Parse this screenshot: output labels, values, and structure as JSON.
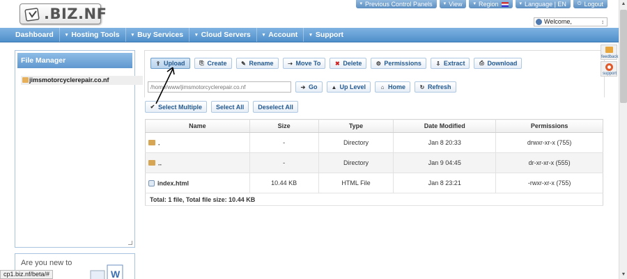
{
  "header": {
    "logo_text": ".BIZ.NF",
    "toplinks": [
      {
        "label": "Previous Control Panels"
      },
      {
        "label": "View"
      },
      {
        "label": "Region"
      },
      {
        "label": "Language | EN"
      },
      {
        "label": "Logout"
      }
    ],
    "welcome": "Welcome,"
  },
  "nav": {
    "items": [
      {
        "label": "Dashboard"
      },
      {
        "label": "Hosting Tools"
      },
      {
        "label": "Buy Services"
      },
      {
        "label": "Cloud Servers"
      },
      {
        "label": "Account"
      },
      {
        "label": "Support"
      }
    ]
  },
  "sidebar": {
    "title": "File Manager",
    "tree": [
      {
        "label": "jimsmotorcyclerepair.co.nf"
      }
    ],
    "new_box_text": "Are you new to"
  },
  "toolbar": {
    "buttons": [
      {
        "label": "Upload",
        "icon": "upload-icon",
        "glyph": "⇪"
      },
      {
        "label": "Create",
        "icon": "create-icon",
        "glyph": "⎘"
      },
      {
        "label": "Rename",
        "icon": "rename-icon",
        "glyph": "✎"
      },
      {
        "label": "Move To",
        "icon": "move-icon",
        "glyph": "⇢"
      },
      {
        "label": "Delete",
        "icon": "delete-icon",
        "glyph": "✖"
      },
      {
        "label": "Permissions",
        "icon": "gear-icon",
        "glyph": "⚙"
      },
      {
        "label": "Extract",
        "icon": "extract-icon",
        "glyph": "⇩"
      },
      {
        "label": "Download",
        "icon": "download-icon",
        "glyph": "⎙"
      }
    ]
  },
  "path": {
    "value": "/home/www/jimsmotorcyclerepair.co.nf",
    "buttons": [
      {
        "label": "Go",
        "glyph": "➔"
      },
      {
        "label": "Up Level",
        "glyph": "▲"
      },
      {
        "label": "Home",
        "glyph": "⌂"
      },
      {
        "label": "Refresh",
        "glyph": "↻"
      }
    ]
  },
  "selection": {
    "select_multiple": "Select Multiple",
    "select_all": "Select All",
    "deselect_all": "Deselect All"
  },
  "table": {
    "columns": [
      "Name",
      "Size",
      "Type",
      "Date Modified",
      "Permissions"
    ],
    "rows": [
      {
        "name": ".",
        "size": "-",
        "type": "Directory",
        "date": "Jan 8 20:33",
        "perms": "drwxr-xr-x (755)",
        "kind": "folder"
      },
      {
        "name": "..",
        "size": "-",
        "type": "Directory",
        "date": "Jan 9 04:45",
        "perms": "dr-xr-xr-x (555)",
        "kind": "folder"
      },
      {
        "name": "index.html",
        "size": "10.44 KB",
        "type": "HTML File",
        "date": "Jan 8 23:21",
        "perms": "-rwxr-xr-x (755)",
        "kind": "html"
      }
    ],
    "footer": "Total: 1 file, Total file size: 10.44 KB"
  },
  "sidetabs": [
    {
      "label": "feedback"
    },
    {
      "label": "support"
    }
  ],
  "statusbar": "cp1.biz.nf/beta/#",
  "colors": {
    "nav_blue": "#5f98cf",
    "button_text": "#245a91",
    "folder": "#d7a654"
  }
}
